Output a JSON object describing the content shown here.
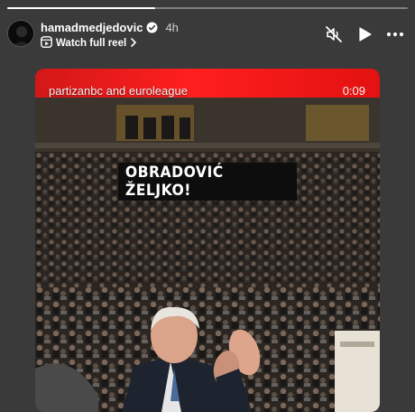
{
  "story": {
    "progress_fraction": 0.37
  },
  "header": {
    "username": "hamadmedjedovic",
    "time_ago": "4h",
    "watch_label": "Watch full reel",
    "verified_icon": "verified-badge-icon",
    "reel_icon": "reel-icon",
    "chevron_icon": "chevron-right-icon"
  },
  "controls": {
    "mute_icon": "speaker-muted-icon",
    "play_icon": "play-icon",
    "more_icon": "more-options-icon"
  },
  "reel": {
    "source_label": "partizanbc and euroleague",
    "timer": "0:09",
    "caption": "OBRADOVIĆ ŽELJKO!"
  },
  "colors": {
    "background": "#3a3a3a",
    "banner_red": "#ff1f1f",
    "caption_bg": "#0d0d0d"
  }
}
